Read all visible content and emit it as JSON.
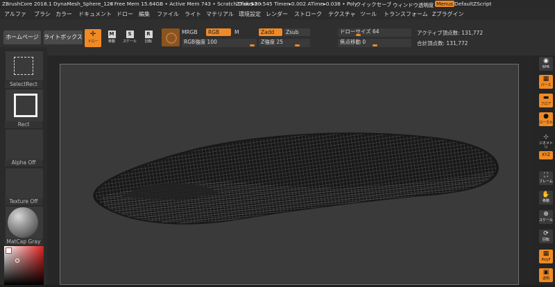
{
  "titlebar": {
    "app": "ZBrushCore 2018.1 DynaMesh_Sphere_128",
    "mem": "• Free Mem 15.64GB • Active Mem 743 • Scratch Disk 52 •",
    "timer": "ZTime▸90.545 Timer▸0.002 ATime▸0.038 • Poly",
    "quicksave": "クイックセーブ",
    "transparency": "ウィンドウ透明度",
    "menus": "Menus",
    "script": "DefaultZScript"
  },
  "menubar": [
    "アルファ",
    "ブラシ",
    "カラー",
    "ドキュメント",
    "ドロー",
    "編集",
    "ファイル",
    "ライト",
    "マテリアル",
    "環境設定",
    "レンダー",
    "ストローク",
    "テクスチャ",
    "ツール",
    "トランスフォーム",
    "Zプラグイン"
  ],
  "toolbar": {
    "home_label": "ホームページ",
    "lightbox_label": "ライトボックス",
    "draw_label": "ドロー",
    "move_label": "移動",
    "scale_label": "スケール",
    "rotate_label": "回転",
    "mrgb": "MRGB",
    "rgb": "RGB",
    "m": "M",
    "zadd": "Zadd",
    "zsub": "Zsub",
    "rgb_intensity": "RGB強度 100",
    "z_intensity": "Z強度 25",
    "draw_size": "ドローサイズ 64",
    "focal_shift": "焦点移動 0",
    "active_points": "アクティブ頂点数: 131,772",
    "total_points": "合計頂点数: 131,772"
  },
  "leftshelf": {
    "selectrect": "SelectRect",
    "rect": "Rect",
    "alpha": "Alpha Off",
    "texture": "Texture Off",
    "matcap": "MatCap Gray"
  },
  "rightshelf": [
    {
      "name": "bpr",
      "label": "BPR"
    },
    {
      "name": "perspective",
      "label": "パース"
    },
    {
      "name": "floor",
      "label": "フロア"
    },
    {
      "name": "local",
      "label": "ローカル"
    },
    {
      "name": "gizmo",
      "label": "ジオメトリ"
    },
    {
      "name": "xyz",
      "label": "XYZ"
    },
    {
      "name": "frame",
      "label": "フレーム"
    },
    {
      "name": "move",
      "label": "移動"
    },
    {
      "name": "scale",
      "label": "スケール"
    },
    {
      "name": "rotate",
      "label": "回転"
    },
    {
      "name": "polyf",
      "label": "PolyF"
    },
    {
      "name": "transp",
      "label": "透明"
    }
  ],
  "colors": {
    "accent": "#f08a24",
    "panel": "#2f2f2f",
    "canvas": "#3a3a3a"
  }
}
